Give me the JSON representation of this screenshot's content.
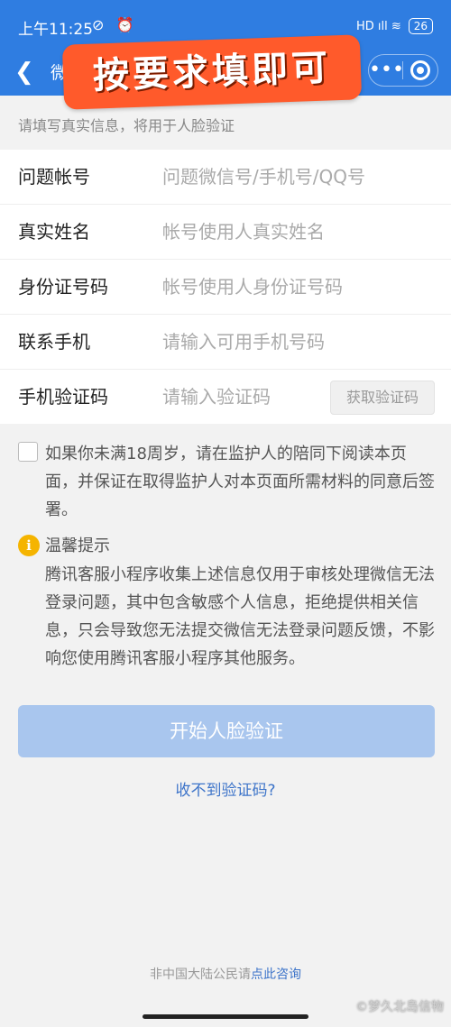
{
  "status_bar": {
    "time": "上午11:25",
    "left_icons": "⊘ ⏰",
    "network": "HD ıll ≋",
    "battery": "26"
  },
  "nav": {
    "title_fragment": "微",
    "more_icon": "•••"
  },
  "sticker": {
    "text": "按要求填即可"
  },
  "hint": "请填写真实信息，将用于人脸验证",
  "form": {
    "rows": [
      {
        "label": "问题帐号",
        "placeholder": "问题微信号/手机号/QQ号"
      },
      {
        "label": "真实姓名",
        "placeholder": "帐号使用人真实姓名"
      },
      {
        "label": "身份证号码",
        "placeholder": "帐号使用人身份证号码"
      },
      {
        "label": "联系手机",
        "placeholder": "请输入可用手机号码"
      },
      {
        "label": "手机验证码",
        "placeholder": "请输入验证码"
      }
    ],
    "code_button": "获取验证码"
  },
  "agreement": "如果你未满18周岁，请在监护人的陪同下阅读本页面，并保证在取得监护人对本页面所需材料的同意后签署。",
  "notice": {
    "icon": "i",
    "title": "温馨提示",
    "body": "腾讯客服小程序收集上述信息仅用于审核处理微信无法登录问题，其中包含敏感个人信息，拒绝提供相关信息，只会导致您无法提交微信无法登录问题反馈，不影响您使用腾讯客服小程序其他服务。"
  },
  "start_button": "开始人脸验证",
  "resend_link": "收不到验证码?",
  "footer": {
    "text": "非中国大陆公民请",
    "link": "点此咨询"
  },
  "watermark": "©梦久北岛信物",
  "colors": {
    "brand_blue": "#2f7de1",
    "button_disabled": "#a9c6ee",
    "link": "#3d74c9",
    "sticker": "#ff5a2b",
    "info": "#f5b400"
  }
}
